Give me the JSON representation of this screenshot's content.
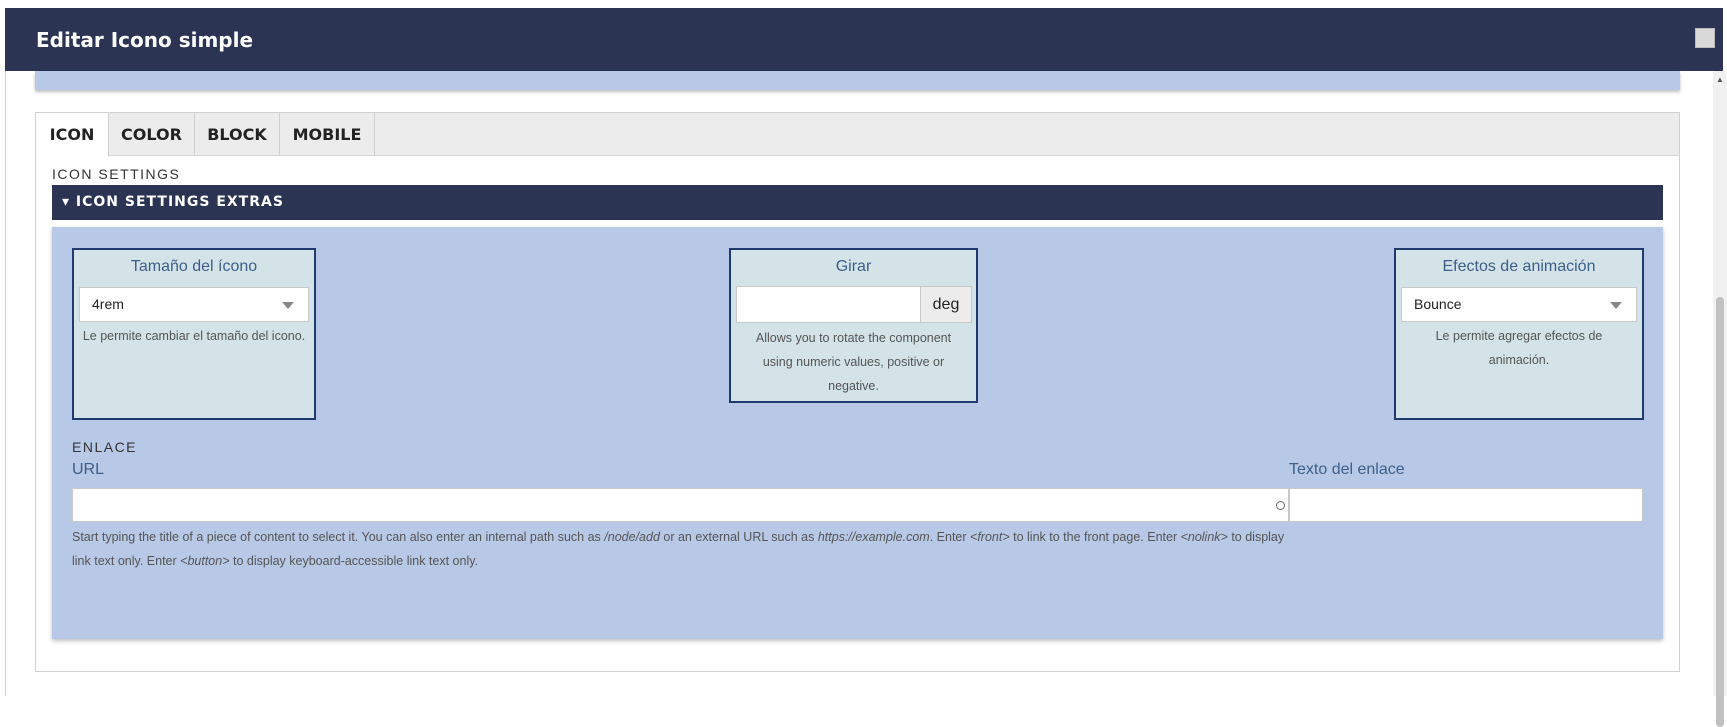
{
  "dialog": {
    "title": "Editar Icono simple"
  },
  "tabs": [
    {
      "label": "ICON",
      "active": true
    },
    {
      "label": "COLOR",
      "active": false
    },
    {
      "label": "BLOCK",
      "active": false
    },
    {
      "label": "MOBILE",
      "active": false
    }
  ],
  "icon_settings": {
    "section_label": "ICON SETTINGS",
    "details_summary": "▾ ICON SETTINGS EXTRAS",
    "size": {
      "label": "Tamaño del ícono",
      "value": "4rem",
      "help": "Le permite cambiar el tamaño del icono."
    },
    "rotate": {
      "label": "Girar",
      "value": "",
      "suffix": "deg",
      "help": "Allows you to rotate the component using numeric values, positive or negative."
    },
    "animation": {
      "label": "Efectos de animación",
      "value": "Bounce",
      "help": "Le permite agregar efectos de animación."
    }
  },
  "link": {
    "section_label": "ENLACE",
    "url_label": "URL",
    "url_value": "",
    "text_label": "Texto del enlace",
    "text_value": "",
    "help": {
      "p1": "Start typing the title of a piece of content to select it. You can also enter an internal path such as ",
      "e1": "/node/add",
      "p2": " or an external URL such as ",
      "e2": "https://example.com",
      "p3": ". Enter ",
      "e3": "<front>",
      "p4": " to link to the front page. Enter ",
      "e4": "<nolink>",
      "p5": " to display link text only. Enter ",
      "e5": "<button>",
      "p6": " to display keyboard-accessible link text only."
    }
  },
  "colors": {
    "header_bg": "#2b3553",
    "panel_bg": "#b7c9e6",
    "card_bg": "#d3e3e8",
    "card_border": "#1e3a6e",
    "label_color": "#3d5f8a"
  }
}
